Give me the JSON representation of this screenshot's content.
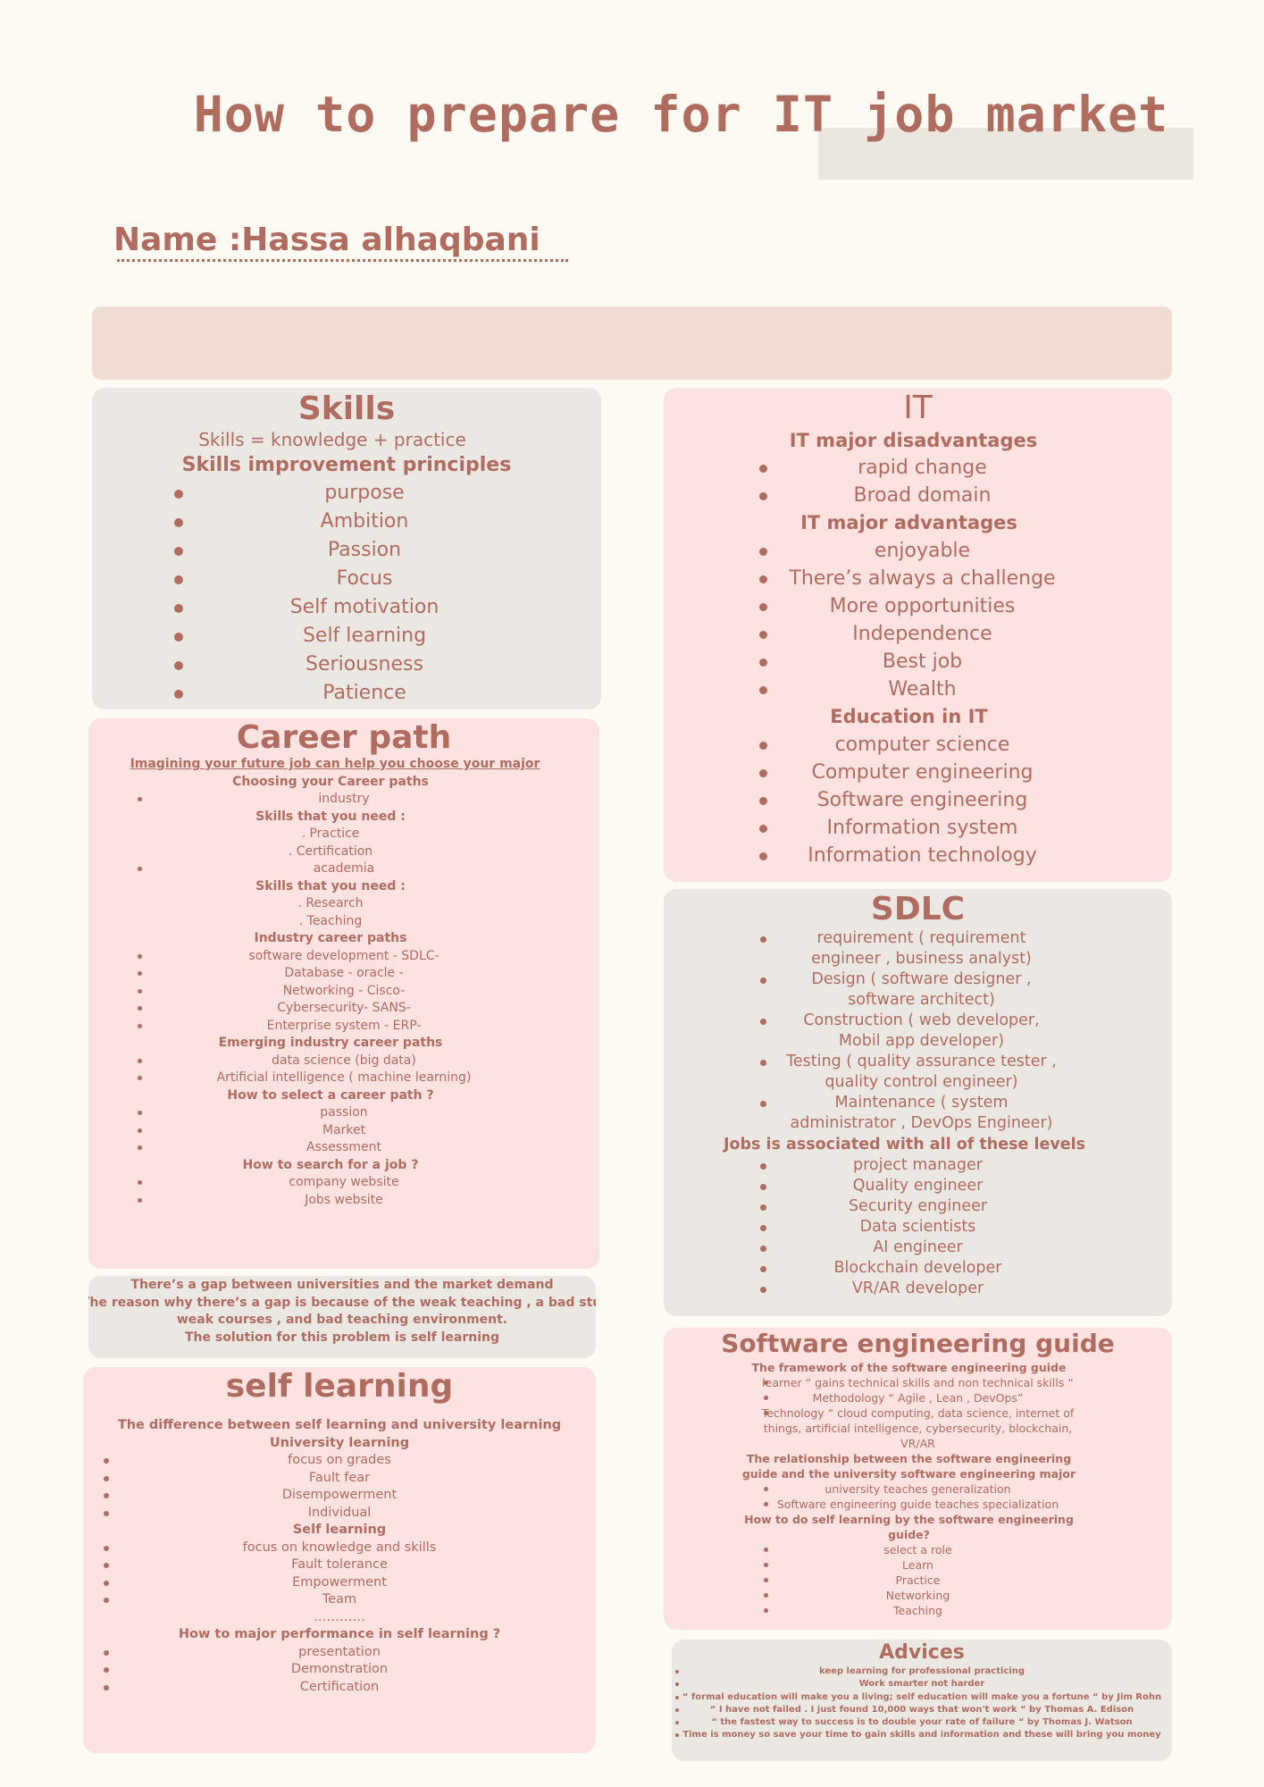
{
  "header": {
    "title": "How to prepare for IT job market",
    "name": "Name :Hassa alhaqbani"
  },
  "skills": {
    "title": "Skills",
    "formula": "Skills = knowledge + practice",
    "subtitle": "Skills improvement principles",
    "items": [
      "purpose",
      "Ambition",
      "Passion",
      "Focus",
      "Self motivation",
      "Self learning",
      "Seriousness",
      "Patience"
    ]
  },
  "it": {
    "title": "IT",
    "disadvantages_heading": "IT major disadvantages",
    "disadvantages": [
      "rapid change",
      "Broad domain"
    ],
    "advantages_heading": "IT major advantages",
    "advantages": [
      "enjoyable",
      "There’s always a challenge",
      "More opportunities",
      "Independence",
      "Best job",
      "Wealth"
    ],
    "education_heading": "Education in IT",
    "education": [
      "computer science",
      "Computer engineering",
      "Software engineering",
      "Information system",
      "Information technology"
    ]
  },
  "career": {
    "title": "Career path",
    "intro": "Imagining your future job can help you choose your major",
    "choosing": "Choosing your Career paths",
    "industry": "industry",
    "skills_heading_1": "Skills that you need :",
    "practice": ". Practice",
    "certification": ". Certification",
    "academia": "academia",
    "skills_heading_2": "Skills that you need :",
    "research": ". Research",
    "teaching": ". Teaching",
    "industry_heading": "Industry career paths",
    "industry_paths": [
      "software development - SDLC-",
      "Database - oracle -",
      "Networking - Cisco-",
      "Cybersecurity- SANS-",
      "Enterprise system - ERP-"
    ],
    "emerging_heading": "Emerging industry career paths",
    "emerging_paths": [
      "data science (big data)",
      "Artificial intelligence ( machine learning)"
    ],
    "select_heading": "How to select a career path ?",
    "select_items": [
      "passion",
      "Market",
      "Assessment"
    ],
    "search_heading": "How to search for a job ?",
    "search_items": [
      "company website",
      "Jobs website"
    ]
  },
  "gap": {
    "line1": "There’s a gap between universities and the market demand",
    "line2": "The reason why there’s a gap is because of the weak teaching , a bad student,",
    "line3": "weak courses , and bad teaching environment.",
    "line4": "The solution for this problem is self learning"
  },
  "self_learning": {
    "title": "self learning",
    "difference": "The difference between self learning and university learning",
    "university_heading": "University learning",
    "university_items": [
      "focus on grades",
      "Fault fear",
      "Disempowerment",
      "Individual"
    ],
    "self_heading": "Self learning",
    "self_items": [
      "focus on knowledge and skills",
      "Fault tolerance",
      "Empowerment",
      "Team"
    ],
    "dots": "…………",
    "performance_heading": "How to major performance in self learning ?",
    "performance_items": [
      "presentation",
      "Demonstration",
      "Certification"
    ]
  },
  "sdlc": {
    "title": "SDLC",
    "stages": [
      "requirement ( requirement engineer , business analyst)",
      "Design ( software designer , software architect)",
      "Construction ( web developer, Mobil app developer)",
      "Testing ( quality assurance tester , quality control engineer)",
      "Maintenance ( system administrator , DevOps Engineer)"
    ],
    "jobs_heading": "Jobs is associated with all of these levels",
    "jobs": [
      "project manager",
      "Quality engineer",
      "Security engineer",
      "Data scientists",
      "AI engineer",
      "Blockchain developer",
      "VR/AR developer"
    ]
  },
  "seguide": {
    "title": "Software engineering guide",
    "framework_heading": "The framework of the software engineering guide",
    "framework_items": [
      "learner “ gains technical skills and non technical skills “",
      "Methodology  “ Agile , Lean , DevOps”",
      "Technology “ cloud computing, data science, internet of things, artificial intelligence, cybersecurity, blockchain, VR/AR"
    ],
    "relationship_heading_1": "The relationship between the software engineering",
    "relationship_heading_2": "guide and the university software engineering major",
    "relationship_items": [
      "university teaches generalization",
      "Software engineering guide teaches specialization"
    ],
    "how_heading_1": "How to  do self learning by the software engineering",
    "how_heading_2": "guide?",
    "how_items": [
      "select a role",
      "Learn",
      "Practice",
      "Networking",
      "Teaching"
    ]
  },
  "advices": {
    "title": "Advices",
    "items": [
      "keep learning for professional practicing",
      "Work smarter not harder",
      "“ formal education will make you a living; self education will make you a fortune “ by Jim Rohn",
      "“ I have not failed . I just found 10,000 ways that won't work “ by Thomas A. Edison",
      "“ the fastest way to success is to double your rate of failure “ by Thomas J. Watson",
      "Time is money so save your time to gain skills and information and these will bring you money"
    ]
  }
}
